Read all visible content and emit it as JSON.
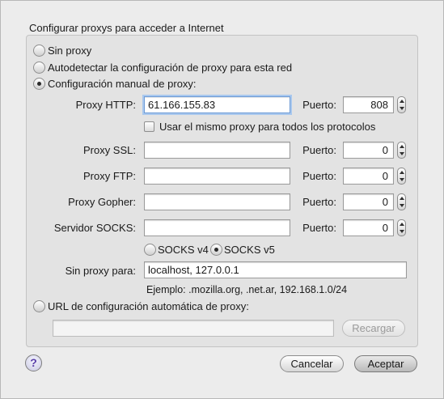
{
  "dialog": {
    "title": "Configurar proxys para acceder a Internet"
  },
  "mode": {
    "none": "Sin proxy",
    "auto_detect": "Autodetectar la configuración de proxy para esta red",
    "manual": "Configuración manual de proxy:",
    "pac": "URL de configuración automática de proxy:",
    "selected": "manual"
  },
  "proxies": {
    "port_label": "Puerto:",
    "http": {
      "label": "Proxy HTTP:",
      "host": "61.166.155.83",
      "port": "808"
    },
    "same_proxy_label": "Usar el mismo proxy para todos los protocolos",
    "ssl": {
      "label": "Proxy SSL:",
      "host": "",
      "port": "0"
    },
    "ftp": {
      "label": "Proxy FTP:",
      "host": "",
      "port": "0"
    },
    "gopher": {
      "label": "Proxy Gopher:",
      "host": "",
      "port": "0"
    },
    "socks": {
      "label": "Servidor SOCKS:",
      "host": "",
      "port": "0"
    },
    "socks_v4": "SOCKS v4",
    "socks_v5": "SOCKS v5",
    "socks_selected": "v5"
  },
  "no_proxy": {
    "label": "Sin proxy para:",
    "value": "localhost, 127.0.0.1",
    "example": "Ejemplo: .mozilla.org, .net.ar, 192.168.1.0/24"
  },
  "pac": {
    "url": "",
    "reload_label": "Recargar"
  },
  "buttons": {
    "help": "?",
    "cancel": "Cancelar",
    "accept": "Aceptar"
  }
}
